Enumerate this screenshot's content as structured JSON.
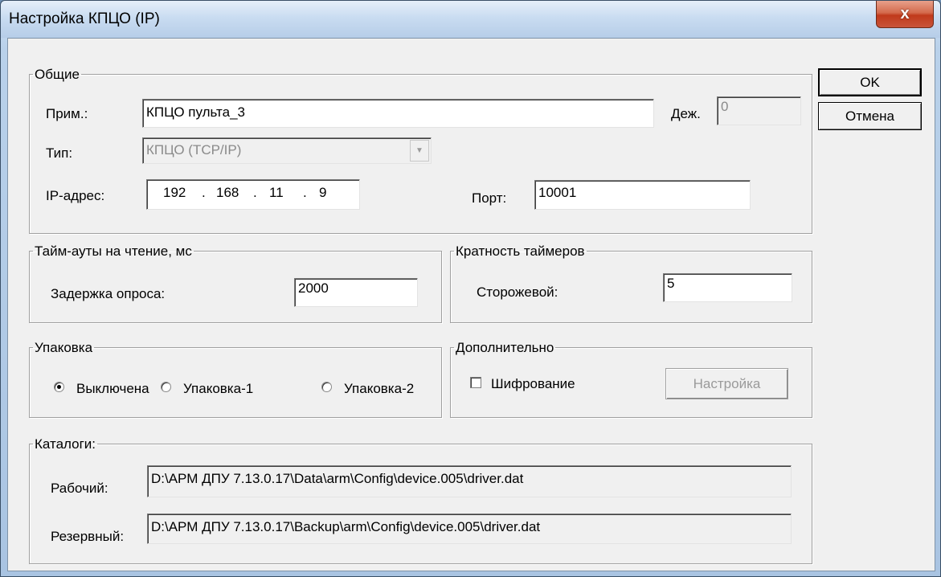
{
  "window": {
    "title": "Настройка КПЦО (IP)",
    "close_glyph": "x"
  },
  "buttons": {
    "ok": "OK",
    "cancel": "Отмена"
  },
  "general": {
    "legend": "Общие",
    "note_label": "Прим.:",
    "note_value": "КПЦО пульта_3",
    "duty_label": "Деж.",
    "duty_value": "0",
    "type_label": "Тип:",
    "type_value": "КПЦО (TCP/IP)",
    "ip_label": "IP-адрес:",
    "ip": [
      "192",
      "168",
      "11",
      "9"
    ],
    "ip_dot": ".",
    "port_label": "Порт:",
    "port_value": "10001"
  },
  "timeouts": {
    "legend": "Тайм-ауты на чтение, мс",
    "poll_delay_label": "Задержка опроса:",
    "poll_delay_value": "2000"
  },
  "timers": {
    "legend": "Кратность таймеров",
    "watchdog_label": "Сторожевой:",
    "watchdog_value": "5"
  },
  "packing": {
    "legend": "Упаковка",
    "options": [
      "Выключена",
      "Упаковка-1",
      "Упаковка-2"
    ],
    "selected": "Выключена"
  },
  "extra": {
    "legend": "Дополнительно",
    "encryption_label": "Шифрование",
    "encryption_checked": false,
    "settings_button": "Настройка"
  },
  "catalogs": {
    "legend": "Каталоги:",
    "work_label": "Рабочий:",
    "work_path": "D:\\АРМ ДПУ 7.13.0.17\\Data\\arm\\Config\\device.005\\driver.dat",
    "backup_label": "Резервный:",
    "backup_path": "D:\\АРМ ДПУ 7.13.0.17\\Backup\\arm\\Config\\device.005\\driver.dat"
  }
}
